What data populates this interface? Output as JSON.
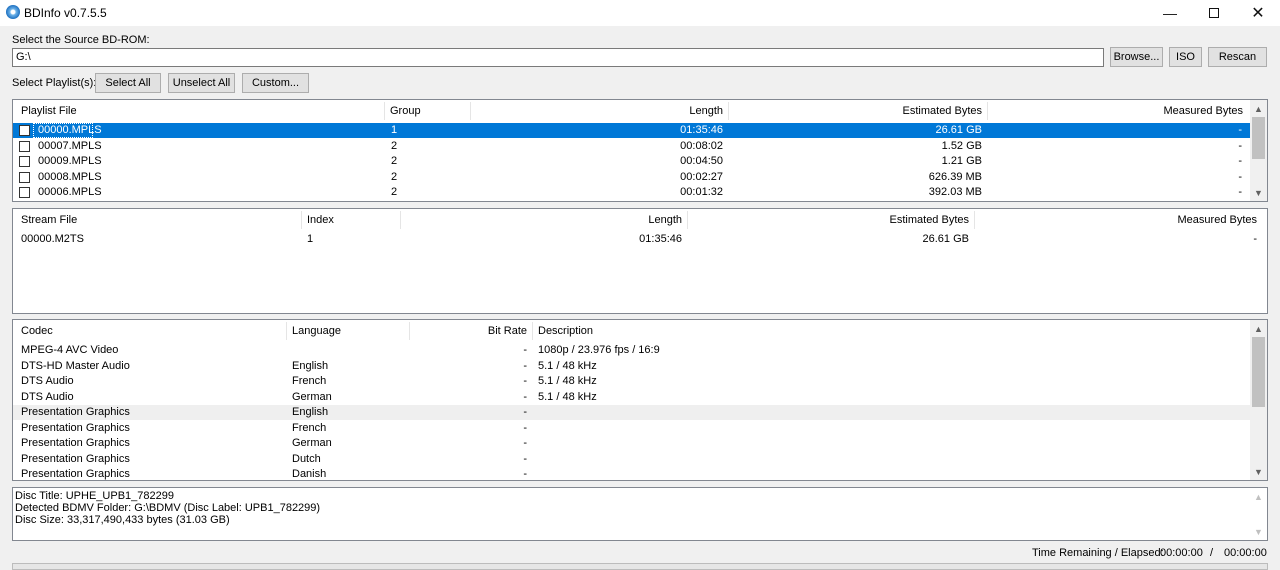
{
  "window": {
    "title": "BDInfo v0.7.5.5"
  },
  "source": {
    "label": "Select the Source BD-ROM:",
    "path": "G:\\",
    "browse_label": "Browse...",
    "iso_label": "ISO",
    "rescan_label": "Rescan"
  },
  "playlist_controls": {
    "label": "Select Playlist(s):",
    "select_all": "Select All",
    "unselect_all": "Unselect All",
    "custom": "Custom..."
  },
  "playlists": {
    "headers": {
      "file": "Playlist File",
      "group": "Group",
      "length": "Length",
      "est_bytes": "Estimated Bytes",
      "measured_bytes": "Measured Bytes"
    },
    "rows": [
      {
        "file": "00000.MPLS",
        "group": "1",
        "length": "01:35:46",
        "est": "26.61 GB",
        "measured": "-"
      },
      {
        "file": "00007.MPLS",
        "group": "2",
        "length": "00:08:02",
        "est": "1.52 GB",
        "measured": "-"
      },
      {
        "file": "00009.MPLS",
        "group": "2",
        "length": "00:04:50",
        "est": "1.21 GB",
        "measured": "-"
      },
      {
        "file": "00008.MPLS",
        "group": "2",
        "length": "00:02:27",
        "est": "626.39 MB",
        "measured": "-"
      },
      {
        "file": "00006.MPLS",
        "group": "2",
        "length": "00:01:32",
        "est": "392.03 MB",
        "measured": "-"
      }
    ],
    "selected_index": 0
  },
  "streams": {
    "headers": {
      "file": "Stream File",
      "index": "Index",
      "length": "Length",
      "est_bytes": "Estimated Bytes",
      "measured_bytes": "Measured Bytes"
    },
    "rows": [
      {
        "file": "00000.M2TS",
        "index": "1",
        "length": "01:35:46",
        "est": "26.61 GB",
        "measured": "-"
      }
    ]
  },
  "codecs": {
    "headers": {
      "codec": "Codec",
      "language": "Language",
      "bitrate": "Bit Rate",
      "description": "Description"
    },
    "rows": [
      {
        "codec": "MPEG-4 AVC Video",
        "language": "",
        "bitrate": "-",
        "description": "1080p / 23.976 fps / 16:9"
      },
      {
        "codec": "DTS-HD Master Audio",
        "language": "English",
        "bitrate": "-",
        "description": "5.1 / 48 kHz"
      },
      {
        "codec": "DTS Audio",
        "language": "French",
        "bitrate": "-",
        "description": "5.1 / 48 kHz"
      },
      {
        "codec": "DTS Audio",
        "language": "German",
        "bitrate": "-",
        "description": "5.1 / 48 kHz"
      },
      {
        "codec": "Presentation Graphics",
        "language": "English",
        "bitrate": "-",
        "description": ""
      },
      {
        "codec": "Presentation Graphics",
        "language": "French",
        "bitrate": "-",
        "description": ""
      },
      {
        "codec": "Presentation Graphics",
        "language": "German",
        "bitrate": "-",
        "description": ""
      },
      {
        "codec": "Presentation Graphics",
        "language": "Dutch",
        "bitrate": "-",
        "description": ""
      },
      {
        "codec": "Presentation Graphics",
        "language": "Danish",
        "bitrate": "-",
        "description": ""
      }
    ],
    "shaded_index": 4
  },
  "disc_info": {
    "line1": "Disc Title: UPHE_UPB1_782299",
    "line2": "Detected BDMV Folder: G:\\BDMV (Disc Label: UPB1_782299)",
    "line3": "Disc Size: 33,317,490,433 bytes (31.03 GB)"
  },
  "status": {
    "label": "Time Remaining / Elapsed:",
    "remaining": "00:00:00",
    "separator": "/",
    "elapsed": "00:00:00"
  }
}
